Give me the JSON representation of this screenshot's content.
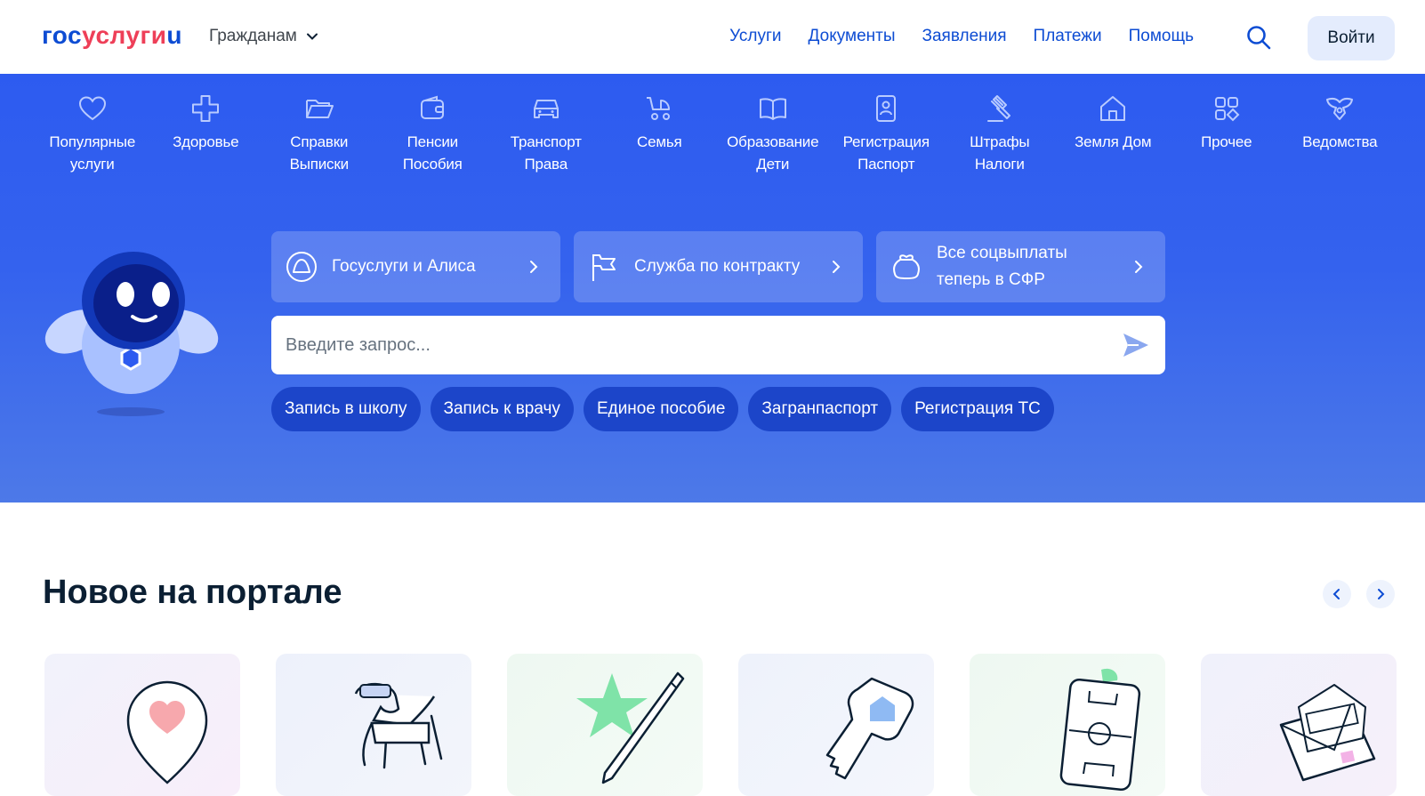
{
  "brand": {
    "logo_part1": "гос",
    "logo_part2": "услуги",
    "logo_part3": "u",
    "blue": "#0d4cd3",
    "red": "#ee3f58",
    "hero_blue": "#3462ee"
  },
  "header": {
    "audience": "Гражданам",
    "nav": [
      "Услуги",
      "Документы",
      "Заявления",
      "Платежи",
      "Помощь"
    ],
    "login": "Войти"
  },
  "categories": [
    {
      "label": "Популярные\nуслуги",
      "icon": "heart-icon"
    },
    {
      "label": "Здоровье",
      "icon": "medical-cross-icon"
    },
    {
      "label": "Справки\nВыписки",
      "icon": "folder-icon"
    },
    {
      "label": "Пенсии\nПособия",
      "icon": "wallet-icon"
    },
    {
      "label": "Транспорт\nПрава",
      "icon": "car-icon"
    },
    {
      "label": "Семья",
      "icon": "stroller-icon"
    },
    {
      "label": "Образование\nДети",
      "icon": "book-icon"
    },
    {
      "label": "Регистрация\nПаспорт",
      "icon": "id-card-icon"
    },
    {
      "label": "Штрафы\nНалоги",
      "icon": "gavel-icon"
    },
    {
      "label": "Земля Дом",
      "icon": "house-icon"
    },
    {
      "label": "Прочее",
      "icon": "grid-icon"
    },
    {
      "label": "Ведомства",
      "icon": "eagle-icon"
    }
  ],
  "promos": [
    {
      "label": "Госуслуги и Алиса",
      "icon": "alice-icon"
    },
    {
      "label": "Служба по контракту",
      "icon": "flag-icon"
    },
    {
      "label": "Все соцвыплаты\nтеперь в СФР",
      "icon": "bag-icon"
    }
  ],
  "search": {
    "placeholder": "Введите запрос..."
  },
  "chips": [
    "Запись в школу",
    "Запись к врачу",
    "Единое пособие",
    "Загранпаспорт",
    "Регистрация ТС"
  ],
  "news": {
    "title": "Новое на портале",
    "tiles": [
      "heart-pin-icon",
      "robot-dog-icon",
      "star-pen-icon",
      "house-key-icon",
      "football-tablet-icon",
      "envelope-icon"
    ]
  }
}
